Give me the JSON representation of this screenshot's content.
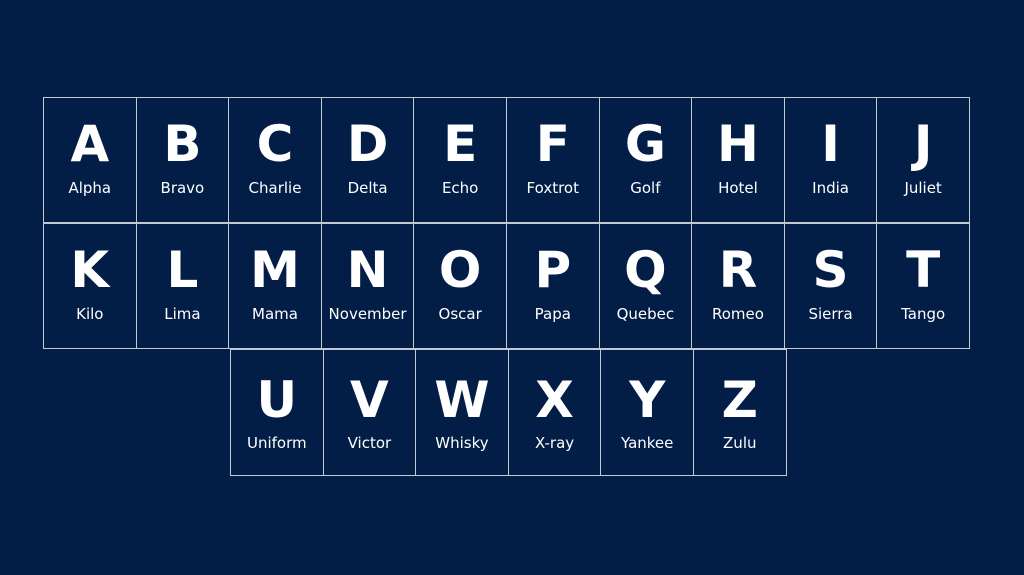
{
  "colors": {
    "background": "#021e47",
    "grid": "#c3c9d3",
    "text": "#ffffff"
  },
  "rows": [
    [
      {
        "letter": "A",
        "word": "Alpha"
      },
      {
        "letter": "B",
        "word": "Bravo"
      },
      {
        "letter": "C",
        "word": "Charlie"
      },
      {
        "letter": "D",
        "word": "Delta"
      },
      {
        "letter": "E",
        "word": "Echo"
      },
      {
        "letter": "F",
        "word": "Foxtrot"
      },
      {
        "letter": "G",
        "word": "Golf"
      },
      {
        "letter": "H",
        "word": "Hotel"
      },
      {
        "letter": "I",
        "word": "India"
      },
      {
        "letter": "J",
        "word": "Juliet"
      }
    ],
    [
      {
        "letter": "K",
        "word": "Kilo"
      },
      {
        "letter": "L",
        "word": "Lima"
      },
      {
        "letter": "M",
        "word": "Mama"
      },
      {
        "letter": "N",
        "word": "November"
      },
      {
        "letter": "O",
        "word": "Oscar"
      },
      {
        "letter": "P",
        "word": "Papa"
      },
      {
        "letter": "Q",
        "word": "Quebec"
      },
      {
        "letter": "R",
        "word": "Romeo"
      },
      {
        "letter": "S",
        "word": "Sierra"
      },
      {
        "letter": "T",
        "word": "Tango"
      }
    ],
    [
      {
        "letter": "U",
        "word": "Uniform"
      },
      {
        "letter": "V",
        "word": "Victor"
      },
      {
        "letter": "W",
        "word": "Whisky"
      },
      {
        "letter": "X",
        "word": "X-ray"
      },
      {
        "letter": "Y",
        "word": "Yankee"
      },
      {
        "letter": "Z",
        "word": "Zulu"
      }
    ]
  ]
}
